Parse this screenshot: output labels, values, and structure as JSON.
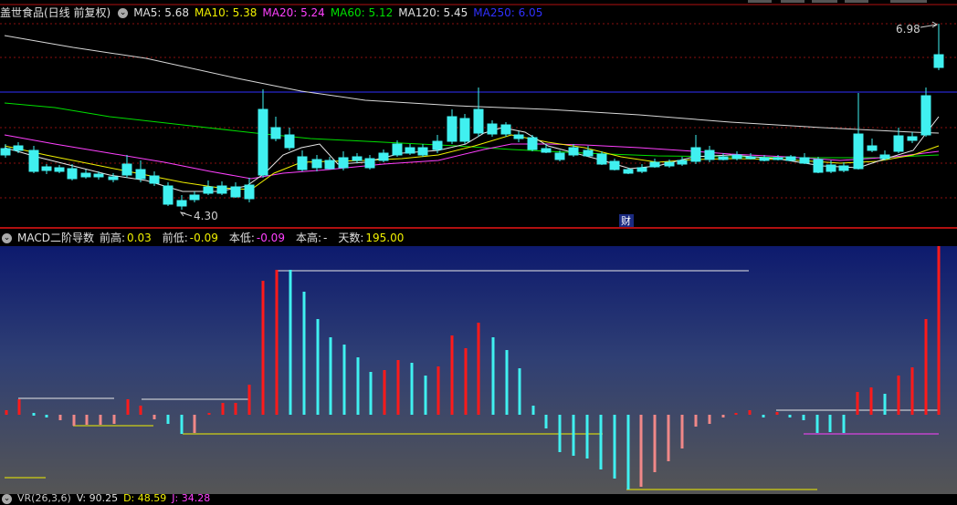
{
  "main_panel": {
    "title": "盖世食品(日线 前复权)",
    "indicators": [
      {
        "label": "MA5: 5.68",
        "color": "#e0e0e0"
      },
      {
        "label": "MA10: 5.38",
        "color": "#f0f000"
      },
      {
        "label": "MA20: 5.24",
        "color": "#ff40ff"
      },
      {
        "label": "MA60: 5.12",
        "color": "#00e000"
      },
      {
        "label": "MA120: 5.45",
        "color": "#e0e0e0"
      },
      {
        "label": "MA250: 6.05",
        "color": "#3030ff"
      }
    ],
    "high_label": "6.98",
    "low_label": "4.30",
    "event_badge": "财"
  },
  "macd_panel": {
    "title": "MACD二阶导数",
    "stats": [
      {
        "label": "前高:",
        "value": "0.03",
        "color": "#f0f000"
      },
      {
        "label": "前低:",
        "value": "-0.09",
        "color": "#f0f000"
      },
      {
        "label": "本低:",
        "value": "-0.09",
        "color": "#ff40ff"
      },
      {
        "label": "本高:",
        "value": "-",
        "color": "#e0e0e0"
      },
      {
        "label": "天数:",
        "value": "195.00",
        "color": "#f0f000"
      }
    ]
  },
  "bottom_panel": {
    "items": [
      {
        "label": "VR(26,3,6)",
        "color": "#c8c8c8"
      },
      {
        "label": "V: 90.25",
        "color": "#e0e0e0"
      },
      {
        "label": "D: 48.59",
        "color": "#f0f000"
      },
      {
        "label": "J: 34.28",
        "color": "#ff40ff"
      }
    ]
  },
  "chart_data": [
    {
      "type": "candlestick",
      "title": "盖世食品(日线 前复权)",
      "annotations": {
        "high": 6.98,
        "low": 4.3
      },
      "moving_averages": {
        "MA5": 5.68,
        "MA10": 5.38,
        "MA20": 5.24,
        "MA60": 5.12,
        "MA120": 5.45,
        "MA250": 6.05
      }
    },
    {
      "type": "bar",
      "title": "MACD二阶导数",
      "stats": {
        "前高": 0.03,
        "前低": -0.09,
        "本低": -0.09,
        "本高": "-",
        "天数": 195.0
      }
    }
  ]
}
